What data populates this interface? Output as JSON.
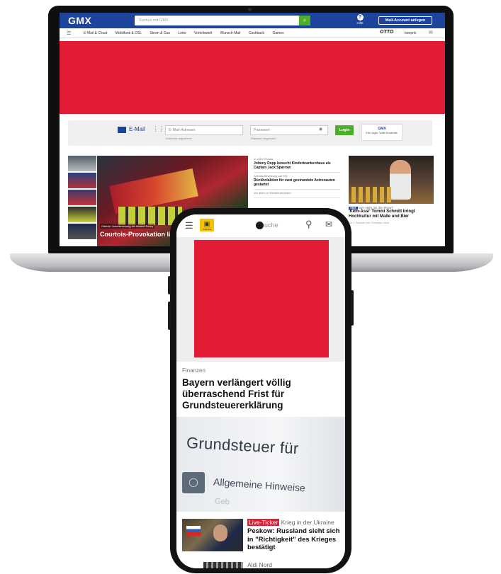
{
  "laptop": {
    "header": {
      "logo": "GMX",
      "search_placeholder": "Suchen mit GMX",
      "search_button_icon": "search-icon",
      "help_label": "Hilfe",
      "mail_account_button": "Mail-Account anlegen"
    },
    "nav": {
      "items": [
        "E-Mail & Cloud",
        "Mobilfunk & DSL",
        "Strom & Gas",
        "Lotto",
        "Vorteilswelt",
        "Wunsch-Mail",
        "Cashback",
        "Games"
      ],
      "partner1": "OTTO",
      "partner2": "bonprix"
    },
    "ad_color": "#e21c34",
    "login": {
      "mail_label": "E-Mail",
      "email_placeholder": "E-Mail-Adresse",
      "email_hint": "Kostenlos registrieren",
      "password_placeholder": "Passwort",
      "password_hint": "Passwort vergessen?",
      "login_button": "Login",
      "partner_line1": "GMX",
      "partner_line2": "Ein Login. Volle Kontrolle."
    },
    "hero": {
      "caption_small": "Galerie: Unterbrechung bei Madrid-Derby",
      "caption": "Courtois-Provokation lä"
    },
    "mid_news": [
      {
        "kicker": "In voller Montur",
        "head": "Johnny Depp besucht Kinderkrankenhaus als Captain Jack Sparrow"
      },
      {
        "kicker": "Spezial-Besatzung auf ISS",
        "head": "Rückholaktion für zwei gestrandete Astronauten gestartet"
      },
      {
        "kicker": "Vor allem in Westdeutschland",
        "head": ""
      }
    ],
    "right_news": {
      "badge": "GMX",
      "kicker": "Wer steht mir die Show?",
      "head": "'Kem-Assi' Tommi Schmitt bringt Hochkultur mit Malle und Bier",
      "meta": "vor 1 Stunde   von Christian Vock"
    }
  },
  "phone": {
    "header": {
      "menu_icon": "menu-icon",
      "logo_text": "WEB.DE",
      "search_text": "uche",
      "search_icon": "search-icon",
      "mail_icon": "mail-icon"
    },
    "ad_color": "#e21c34",
    "article": {
      "section": "Finanzen",
      "title": "Bayern verlängert völlig überraschend Frist für Grundsteuererklärung",
      "photo_text_main": "Grundsteuer für",
      "photo_text_sub": "Allgemeine Hinweise",
      "photo_text_blur": "Geb"
    },
    "news": [
      {
        "badge": "Live-Ticker",
        "kicker": "Krieg in der Ukraine",
        "head": "Peskow: Russland sieht sich in \"Richtigkeit\" des Krieges bestätigt"
      },
      {
        "kicker": "Aldi Nord"
      }
    ]
  }
}
